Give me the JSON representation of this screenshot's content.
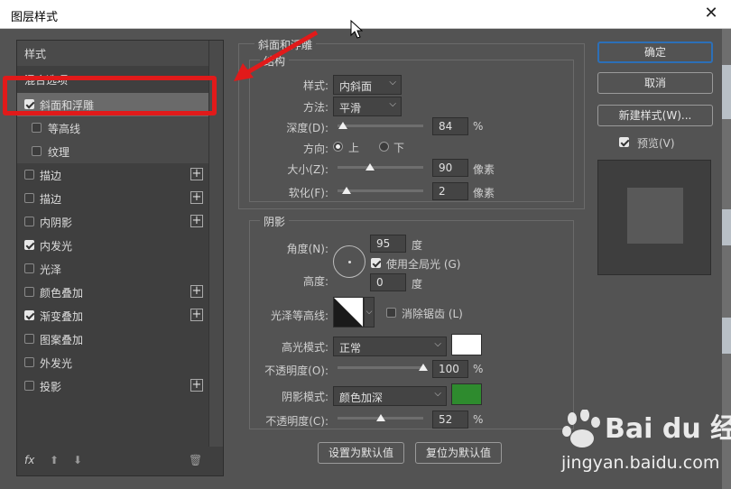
{
  "window": {
    "title": "图层样式",
    "close": "✕"
  },
  "left_panel": {
    "header": "样式",
    "section_label": "混合选项",
    "items": [
      {
        "label": "斜面和浮雕",
        "checked": true,
        "selected": true
      },
      {
        "label": "等高线",
        "checked": false,
        "sub": true
      },
      {
        "label": "纹理",
        "checked": false,
        "sub": true
      },
      {
        "label": "描边",
        "checked": false,
        "plus": "+"
      },
      {
        "label": "描边",
        "checked": false,
        "plus": "+"
      },
      {
        "label": "内阴影",
        "checked": false,
        "plus": "+"
      },
      {
        "label": "内发光",
        "checked": true
      },
      {
        "label": "光泽",
        "checked": false
      },
      {
        "label": "颜色叠加",
        "checked": false,
        "plus": "+"
      },
      {
        "label": "渐变叠加",
        "checked": true,
        "plus": "+"
      },
      {
        "label": "图案叠加",
        "checked": false
      },
      {
        "label": "外发光",
        "checked": false
      },
      {
        "label": "投影",
        "checked": false,
        "plus": "+"
      }
    ],
    "bottom": {
      "fx": "fx",
      "up": "⬆",
      "down": "⬇",
      "trash": "🗑"
    }
  },
  "bevel": {
    "group_title": "斜面和浮雕",
    "structure_title": "结构",
    "style_label": "样式:",
    "style_value": "内斜面",
    "method_label": "方法:",
    "method_value": "平滑",
    "depth_label": "深度(D):",
    "depth_value": "84",
    "depth_unit": "%",
    "depth_level": 0.06,
    "direction_label": "方向:",
    "dir_up": "上",
    "dir_down": "下",
    "size_label": "大小(Z):",
    "size_value": "90",
    "size_unit": "像素",
    "size_level": 0.38,
    "soften_label": "软化(F):",
    "soften_value": "2",
    "soften_unit": "像素",
    "soften_level": 0.1
  },
  "shading": {
    "title": "阴影",
    "angle_label": "角度(N):",
    "angle_value": "95",
    "angle_unit": "度",
    "global_light_label": "使用全局光 (G)",
    "altitude_label": "高度:",
    "altitude_value": "0",
    "altitude_unit": "度",
    "gloss_label": "光泽等高线:",
    "antialias_label": "消除锯齿 (L)",
    "highlight_label": "高光模式:",
    "highlight_value": "正常",
    "highlight_color": "#ffffff",
    "hl_opacity_label": "不透明度(O):",
    "hl_opacity_value": "100",
    "hl_opacity_unit": "%",
    "hl_opacity_level": 1.0,
    "shadow_label": "阴影模式:",
    "shadow_value": "颜色加深",
    "shadow_color": "#2e8b2e",
    "sh_opacity_label": "不透明度(C):",
    "sh_opacity_value": "52",
    "sh_opacity_unit": "%",
    "sh_opacity_level": 0.5
  },
  "footer_buttons": {
    "set_default": "设置为默认值",
    "reset_default": "复位为默认值"
  },
  "right_panel": {
    "ok": "确定",
    "cancel": "取消",
    "new_style": "新建样式(W)...",
    "preview": "预览(V)"
  },
  "watermark": {
    "logo": "Bai du 经验",
    "url": "jingyan.baidu.com"
  }
}
